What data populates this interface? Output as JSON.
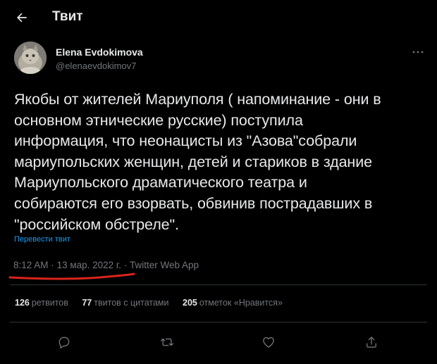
{
  "header": {
    "title": "Твит"
  },
  "tweet": {
    "author_name": "Elena Evdokimova",
    "author_handle": "@elenaevdokimov7",
    "text": "Якобы от жителей Мариуполя ( напоминание - они в\nосновном этнические русские) поступила\nинформация, что неонацисты из \"Азова\"собрали\nмариупольских женщин, детей и стариков в здание\nМариупольского драматического театра и\nсобираются его взорвать, обвинив пострадавших в\n\"российском обстреле\".",
    "translate_label": "Перевести твит",
    "time": "8:12 AM",
    "date": "13 мар. 2022 г.",
    "separator": "·",
    "source": "Twitter Web App"
  },
  "stats": {
    "retweets_count": "126",
    "retweets_label": "ретвитов",
    "quotes_count": "77",
    "quotes_label": "твитов с цитатами",
    "likes_count": "205",
    "likes_label": "отметок «Нравится»"
  },
  "annotation": {
    "underline_color": "#d9241c"
  },
  "colors": {
    "background": "#000000",
    "text": "#e7e9ea",
    "muted": "#71767b",
    "link": "#1d9bf0",
    "divider": "#2f3336"
  },
  "icons": {
    "back": "arrow-left-icon",
    "more": "more-horizontal-icon",
    "reply": "reply-icon",
    "retweet": "retweet-icon",
    "like": "heart-icon",
    "share": "share-icon"
  }
}
